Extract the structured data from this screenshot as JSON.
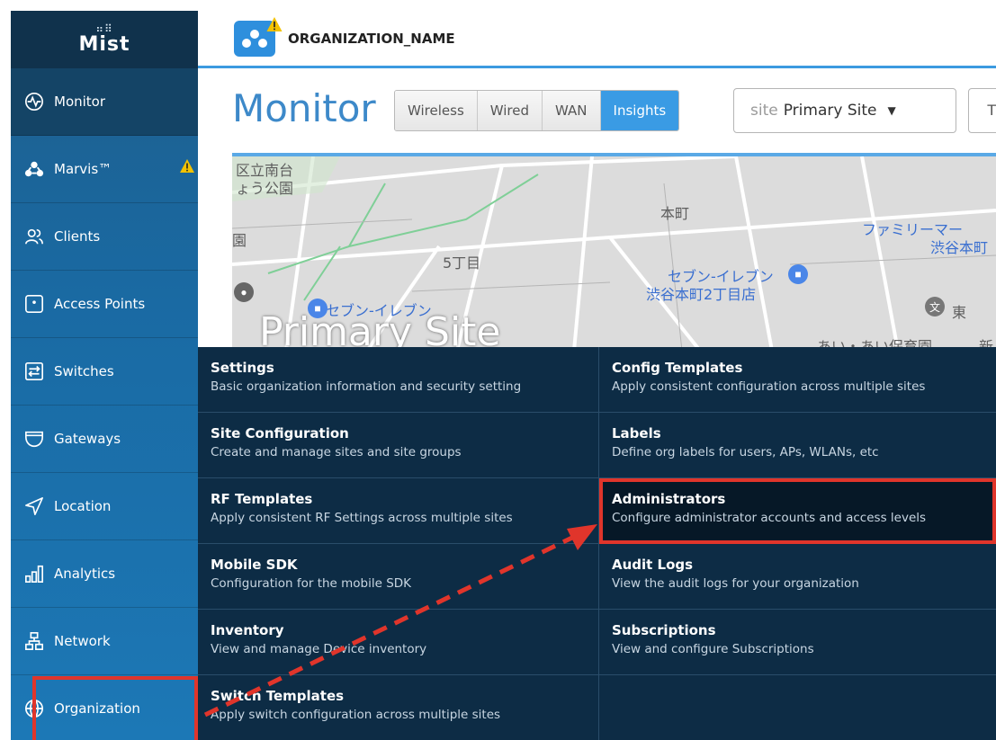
{
  "brand": {
    "logo_text": "Mist"
  },
  "sidebar": {
    "items": [
      {
        "label": "Monitor",
        "icon": "monitor-icon"
      },
      {
        "label": "Marvis™",
        "icon": "marvis-icon",
        "warning": true
      },
      {
        "label": "Clients",
        "icon": "clients-icon"
      },
      {
        "label": "Access Points",
        "icon": "access-point-icon"
      },
      {
        "label": "Switches",
        "icon": "switch-icon"
      },
      {
        "label": "Gateways",
        "icon": "gateway-icon"
      },
      {
        "label": "Location",
        "icon": "location-icon"
      },
      {
        "label": "Analytics",
        "icon": "analytics-icon"
      },
      {
        "label": "Network",
        "icon": "network-icon"
      },
      {
        "label": "Organization",
        "icon": "globe-icon"
      }
    ]
  },
  "header": {
    "org_name": "ORGANIZATION_NAME"
  },
  "monitor": {
    "title": "Monitor",
    "tabs": [
      "Wireless",
      "Wired",
      "WAN",
      "Insights"
    ],
    "active_tab": "Insights",
    "site_label": "site",
    "site_value": "Primary Site",
    "next_select_value": "T"
  },
  "map": {
    "site_name": "Primary Site",
    "labels": [
      "区立南台",
      "ょう公園",
      "本町",
      "5丁目",
      "ファミリーマー",
      "渋谷本町",
      "セブン-イレブン",
      "渋谷本町2丁目店",
      "セブン-イレブン",
      "東",
      "あい・あい保育園",
      "新",
      "園"
    ]
  },
  "org_menu": {
    "left": [
      {
        "title": "Settings",
        "desc": "Basic organization information and security setting"
      },
      {
        "title": "Site Configuration",
        "desc": "Create and manage sites and site groups"
      },
      {
        "title": "RF Templates",
        "desc": "Apply consistent RF Settings across multiple sites"
      },
      {
        "title": "Mobile SDK",
        "desc": "Configuration for the mobile SDK"
      },
      {
        "title": "Inventory",
        "desc": "View and manage Device inventory"
      },
      {
        "title": "Switch Templates",
        "desc": "Apply switch configuration across multiple sites"
      }
    ],
    "right": [
      {
        "title": "Config Templates",
        "desc": "Apply consistent configuration across multiple sites"
      },
      {
        "title": "Labels",
        "desc": "Define org labels for users, APs, WLANs, etc"
      },
      {
        "title": "Administrators",
        "desc": "Configure administrator accounts and access levels"
      },
      {
        "title": "Audit Logs",
        "desc": "View the audit logs for your organization"
      },
      {
        "title": "Subscriptions",
        "desc": "View and configure Subscriptions"
      }
    ],
    "selected": "Administrators"
  },
  "colors": {
    "sidebar": "#1c6ea8",
    "sidebar_active": "#144466",
    "accent": "#3a9be4",
    "menu_bg": "#0d2c45",
    "highlight": "#e0352b",
    "warning": "#f2c200"
  }
}
